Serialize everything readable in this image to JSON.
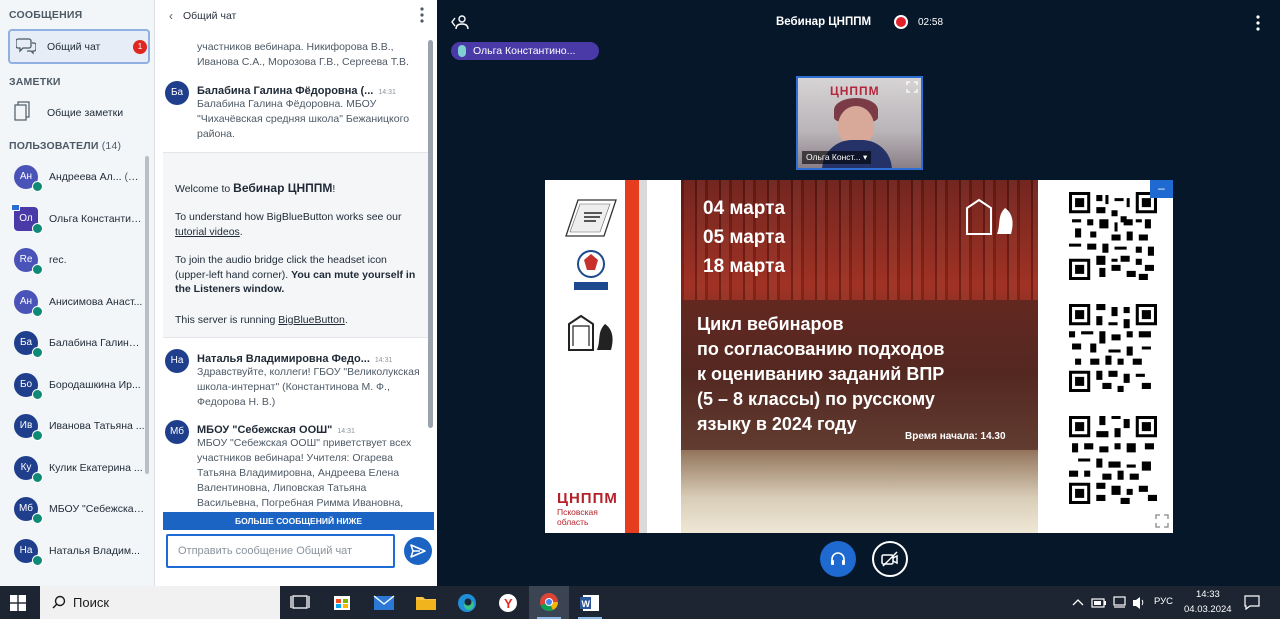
{
  "sidebar": {
    "messages_title": "СООБЩЕНИЯ",
    "chat_item": {
      "label": "Общий чат",
      "badge": "1"
    },
    "notes_title": "ЗАМЕТКИ",
    "notes_item": {
      "label": "Общие заметки"
    },
    "users_title": "ПОЛЬЗОВАТЕЛИ",
    "users_count": "(14)",
    "users": [
      {
        "initials": "Ан",
        "name": "Андреева Ал...",
        "you": "(Вы)",
        "color": "#4a54b8"
      },
      {
        "initials": "Ол",
        "name": "Ольга Константин...",
        "color": "#4a3aa8"
      },
      {
        "initials": "Re",
        "name": "rec.",
        "color": "#4a54b8"
      },
      {
        "initials": "Ан",
        "name": "Анисимова Анаст...",
        "color": "#4a54b8"
      },
      {
        "initials": "Ба",
        "name": "Балабина Галина ...",
        "color": "#1f3f8c"
      },
      {
        "initials": "Бо",
        "name": "Бородашкина Ир...",
        "color": "#1f3f8c"
      },
      {
        "initials": "Ив",
        "name": "Иванова Татьяна ...",
        "color": "#1f3f8c"
      },
      {
        "initials": "Ку",
        "name": "Кулик Екатерина ...",
        "color": "#1f3f8c"
      },
      {
        "initials": "Мб",
        "name": "МБОУ \"Себежская...",
        "color": "#1f3f8c"
      },
      {
        "initials": "На",
        "name": "Наталья Владим...",
        "color": "#1f3f8c"
      }
    ]
  },
  "chat": {
    "back_label": "Общий чат",
    "top_fragment": "участников вебинара. Никифорова В.В., Иванова С.А., Морозова Г.В., Сергеева Т.В.",
    "messages": [
      {
        "initials": "Ба",
        "author": "Балабина Галина Фёдоровна (...",
        "time": "14:31",
        "text": "Балабина Галина Фёдоровна. МБОУ \"Чихачёвская средняя школа\" Бежаницкого района."
      },
      {
        "initials": "На",
        "author": "Наталья Владимировна Федо...",
        "time": "14:31",
        "text": "Здравствуйте, коллеги! ГБОУ \"Великолукская школа-интернат\" (Константинова М. Ф., Федорова Н. В.)"
      },
      {
        "initials": "Мб",
        "author": "МБОУ \"Себежская ООШ\"",
        "time": "14:31",
        "text": "МБОУ \"Себежская ООШ\" приветствует всех участников вебинара! Учителя: Огарева Татьяна Владимировна, Андреева Елена Валентиновна, Липовская Татьяна Васильевна, Погребная Римма Ивановна,"
      }
    ],
    "welcome": {
      "welcome_prefix": "Welcome to ",
      "welcome_name": "Вебинар ЦНППМ",
      "welcome_suffix": "!",
      "understand_text": "To understand how BigBlueButton works see our ",
      "tutorial_link": "tutorial videos",
      "join_text": "To join the audio bridge click the headset icon (upper-left hand corner). ",
      "join_bold": "You can mute yourself in the Listeners window.",
      "server_text": "This server is running ",
      "server_link": "BigBlueButton",
      "server_suffix": "."
    },
    "more_banner": "БОЛЬШЕ СООБЩЕНИЙ НИЖЕ",
    "input_placeholder": "Отправить сообщение Общий чат"
  },
  "main": {
    "title": "Вебинар ЦНППМ",
    "rec_time": "02:58",
    "talker": "Ольга Константино...",
    "webcam": {
      "logo": "ЦНППМ",
      "name": "Ольга Конст..."
    },
    "slide": {
      "dates": [
        "04 марта",
        "05 марта",
        "18 марта"
      ],
      "cycle_lines": [
        "Цикл вебинаров",
        "по согласованию подходов",
        "к оцениванию заданий ВПР",
        "(5 – 8 классы) по русскому",
        "языку в 2024 году"
      ],
      "start_time": "Время начала: 14.30",
      "brand": "ЦНППМ",
      "region": "Псковская область"
    }
  },
  "taskbar": {
    "search_label": "Поиск",
    "lang": "РУС",
    "time": "14:33",
    "date": "04.03.2024"
  },
  "colors": {
    "accent": "#1b64c4",
    "talker_bg": "#4a3aa8",
    "record": "#e3202a",
    "main_bg": "#06172a"
  }
}
